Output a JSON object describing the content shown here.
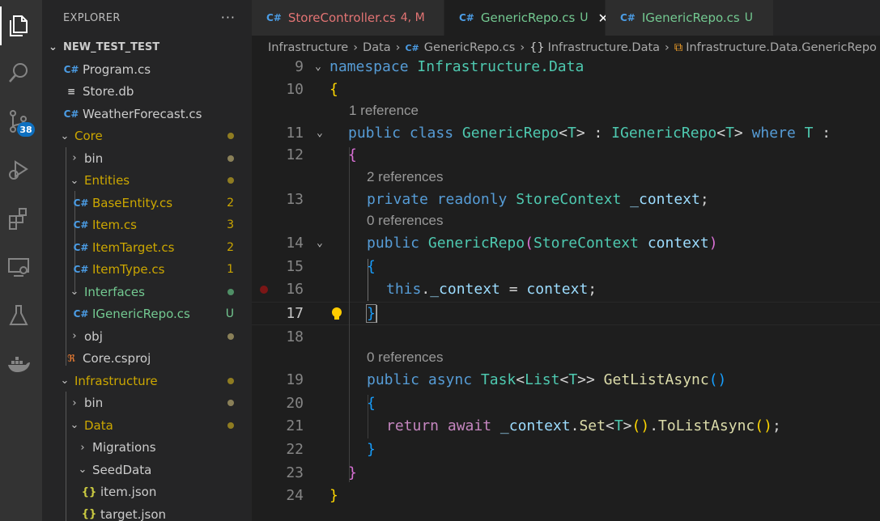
{
  "explorer": {
    "title": "EXPLORER",
    "more": "···",
    "section": "NEW_TEST_TEST",
    "items": [
      {
        "label": "Program.cs",
        "deco": ""
      },
      {
        "label": "Store.db",
        "deco": ""
      },
      {
        "label": "WeatherForecast.cs",
        "deco": ""
      },
      {
        "label": "Core",
        "deco": ""
      },
      {
        "label": "bin",
        "deco": ""
      },
      {
        "label": "Entities",
        "deco": ""
      },
      {
        "label": "BaseEntity.cs",
        "deco": "2"
      },
      {
        "label": "Item.cs",
        "deco": "3"
      },
      {
        "label": "ItemTarget.cs",
        "deco": "2"
      },
      {
        "label": "ItemType.cs",
        "deco": "1"
      },
      {
        "label": "Interfaces",
        "deco": ""
      },
      {
        "label": "IGenericRepo.cs",
        "deco": "U"
      },
      {
        "label": "obj",
        "deco": ""
      },
      {
        "label": "Core.csproj",
        "deco": ""
      },
      {
        "label": "Infrastructure",
        "deco": ""
      },
      {
        "label": "bin",
        "deco": ""
      },
      {
        "label": "Data",
        "deco": ""
      },
      {
        "label": "Migrations",
        "deco": ""
      },
      {
        "label": "SeedData",
        "deco": ""
      },
      {
        "label": "item.json",
        "deco": ""
      },
      {
        "label": "target.json",
        "deco": ""
      }
    ]
  },
  "activity": {
    "scm_badge": "38",
    "icons": [
      "files-icon",
      "search-icon",
      "source-control-icon",
      "run-debug-icon",
      "extensions-icon",
      "remote-explorer-icon",
      "testing-icon",
      "docker-icon"
    ]
  },
  "tabs": [
    {
      "name": "StoreController.cs",
      "status": "4, M"
    },
    {
      "name": "GenericRepo.cs",
      "status": "U",
      "close": "✕"
    },
    {
      "name": "IGenericRepo.cs",
      "status": "U"
    }
  ],
  "breadcrumb": {
    "parts": [
      "Infrastructure",
      "Data",
      "GenericRepo.cs",
      "Infrastructure.Data",
      "Infrastructure.Data.GenericRepo"
    ]
  },
  "editor": {
    "lines": [
      {
        "num": "9"
      },
      {
        "num": "10"
      },
      {
        "num": "11"
      },
      {
        "num": "12"
      },
      {
        "num": "13"
      },
      {
        "num": "14"
      },
      {
        "num": "15"
      },
      {
        "num": "16"
      },
      {
        "num": "17"
      },
      {
        "num": "18"
      },
      {
        "num": "19"
      },
      {
        "num": "20"
      },
      {
        "num": "21"
      },
      {
        "num": "22"
      },
      {
        "num": "23"
      },
      {
        "num": "24"
      }
    ],
    "codelens": [
      "1 reference",
      "2 references",
      "0 references",
      "0 references"
    ],
    "tokens": {
      "namespace": "namespace",
      "ns_name": "Infrastructure.Data",
      "public": "public",
      "class": "class",
      "class_name": "GenericRepo",
      "t": "T",
      "iface": "IGenericRepo",
      "where": "where",
      "private": "private",
      "readonly": "readonly",
      "ctx_type": "StoreContext",
      "ctx_field": "_context",
      "ctx_param": "context",
      "this": "this",
      "async": "async",
      "task": "Task",
      "list": "List",
      "method": "GetListAsync",
      "return": "return",
      "await": "await",
      "set": "Set",
      "tolist": "ToListAsync"
    }
  }
}
